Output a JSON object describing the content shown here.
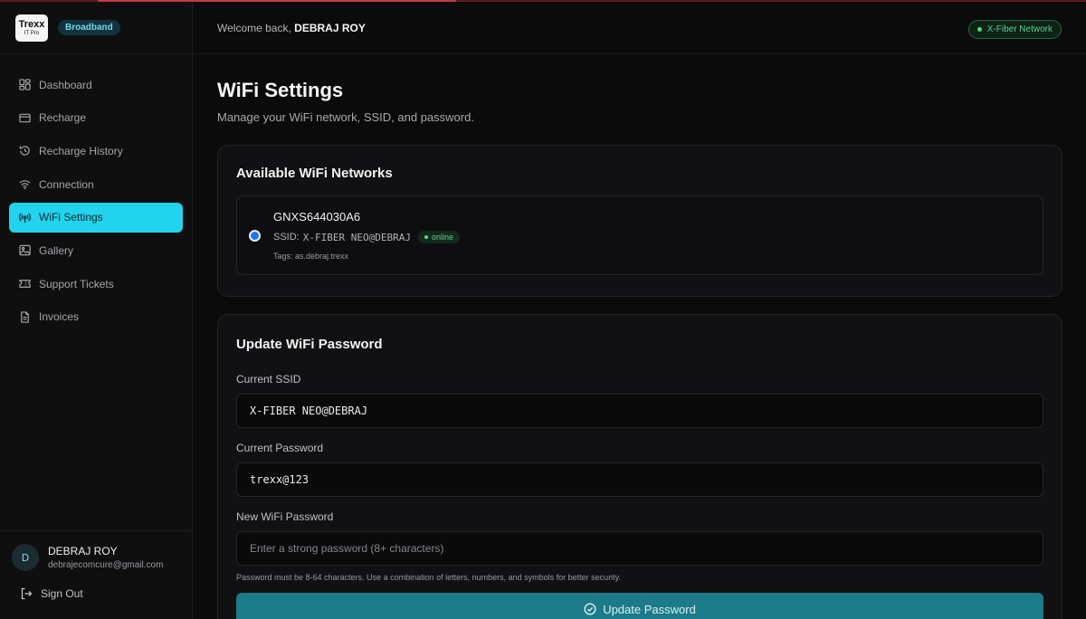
{
  "brand": {
    "logo_line1": "Trexx",
    "logo_line2": "IT Pro",
    "badge": "Broadband"
  },
  "sidebar": {
    "items": [
      {
        "label": "Dashboard",
        "icon": "dashboard-icon"
      },
      {
        "label": "Recharge",
        "icon": "card-icon"
      },
      {
        "label": "Recharge History",
        "icon": "history-icon"
      },
      {
        "label": "Connection",
        "icon": "wifi-icon"
      },
      {
        "label": "WiFi Settings",
        "icon": "antenna-icon",
        "active": true
      },
      {
        "label": "Gallery",
        "icon": "image-icon"
      },
      {
        "label": "Support Tickets",
        "icon": "ticket-icon"
      },
      {
        "label": "Invoices",
        "icon": "document-icon"
      }
    ],
    "user": {
      "initial": "D",
      "name": "DEBRAJ ROY",
      "email": "debrajecomcure@gmail.com"
    },
    "signout_label": "Sign Out"
  },
  "header": {
    "welcome_prefix": "Welcome back,",
    "welcome_name": "DEBRAJ ROY",
    "network_badge": "X-Fiber Network"
  },
  "page": {
    "title": "WiFi Settings",
    "subtitle": "Manage your WiFi network, SSID, and password."
  },
  "networks_card": {
    "title": "Available WiFi Networks",
    "network": {
      "name": "GNXS644030A6",
      "ssid_prefix": "SSID:",
      "ssid": "X-FIBER NEO@DEBRAJ",
      "status": "online",
      "tags": "Tags: as.debraj.trexx"
    }
  },
  "password_card": {
    "title": "Update WiFi Password",
    "current_ssid_label": "Current SSID",
    "current_ssid_value": "X-FIBER NEO@DEBRAJ",
    "current_password_label": "Current Password",
    "current_password_value": "trexx@123",
    "new_password_label": "New WiFi Password",
    "new_password_placeholder": "Enter a strong password (8+ characters)",
    "hint": "Password must be 8-64 characters. Use a combination of letters, numbers, and symbols for better security.",
    "button_label": "Update Password"
  },
  "colors": {
    "accent": "#22d3ee",
    "button": "#1d7a88",
    "online": "#4ade80",
    "background": "#0b0b0c"
  }
}
